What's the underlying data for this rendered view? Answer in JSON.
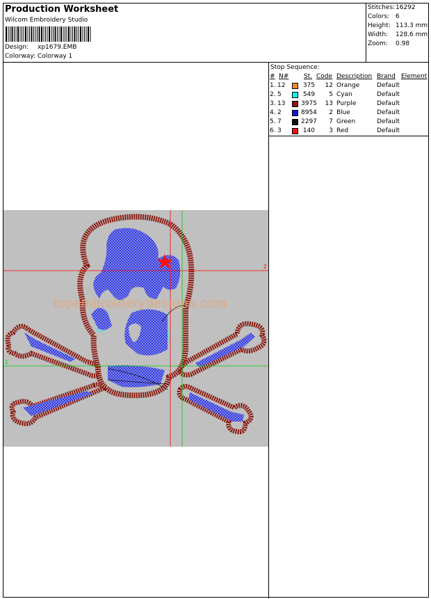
{
  "header": {
    "title": "Production Worksheet",
    "company": "Wilcom  Embroidery Studio",
    "design_label": "Design:",
    "design_value": "xp1679.EMB",
    "colorway_label": "Colorway:",
    "colorway_value": "Colorway  1"
  },
  "stats": [
    {
      "label": "Stitches:",
      "value": "16292"
    },
    {
      "label": "Colors:",
      "value": "6"
    },
    {
      "label": "Height:",
      "value": "113.3 mm"
    },
    {
      "label": "Width:",
      "value": "128.6 mm"
    },
    {
      "label": "Zoom:",
      "value": "0.98"
    }
  ],
  "stop_sequence": {
    "title": "Stop Sequence:",
    "headers": [
      "#",
      "N#",
      "St.",
      "Code",
      "Description",
      "Brand",
      "Element"
    ],
    "rows": [
      {
        "idx": "1.",
        "n": "12",
        "color": "#f08a2c",
        "st": "375",
        "code": "12",
        "desc": "Orange",
        "brand": "Default"
      },
      {
        "idx": "2.",
        "n": "5",
        "color": "#14f0f0",
        "st": "549",
        "code": "5",
        "desc": "Cyan",
        "brand": "Default"
      },
      {
        "idx": "3.",
        "n": "13",
        "color": "#8b1010",
        "st": "3975",
        "code": "13",
        "desc": "Purple",
        "brand": "Default"
      },
      {
        "idx": "4.",
        "n": "2",
        "color": "#1414d8",
        "st": "8954",
        "code": "2",
        "desc": "Blue",
        "brand": "Default"
      },
      {
        "idx": "5.",
        "n": "7",
        "color": "#101010",
        "st": "2297",
        "code": "7",
        "desc": "Green",
        "brand": "Default"
      },
      {
        "idx": "6.",
        "n": "3",
        "color": "#f01010",
        "st": "140",
        "code": "3",
        "desc": "Red",
        "brand": "Default"
      }
    ]
  },
  "preview": {
    "watermark": "topembroiderydesigns.com",
    "guide_label_h": "2",
    "guide_label_v": "1",
    "colors": {
      "background": "#c0c0c0",
      "outline": "#8b1a10",
      "fill": "#2a2ad8",
      "fill_light": "#9aa8f0",
      "guide_red": "#ff0000",
      "guide_green": "#00cc00",
      "star": "#ff1010",
      "watermark": "#e8a070"
    }
  }
}
